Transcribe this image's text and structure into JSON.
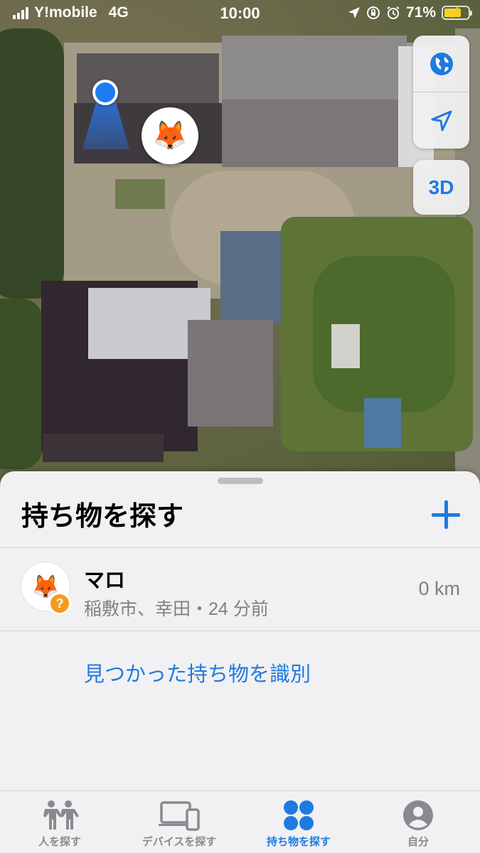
{
  "status_bar": {
    "carrier": "Y!mobile",
    "network": "4G",
    "time": "10:00",
    "battery_percent": "71%",
    "battery_level": 0.71
  },
  "map": {
    "controls": {
      "globe_icon": "globe-icon",
      "location_icon": "location-arrow-icon",
      "threed_label": "3D"
    },
    "pin_icon": "fox-emoji"
  },
  "sheet": {
    "title": "持ち物を探す",
    "add_icon": "plus-icon",
    "items": [
      {
        "name": "マロ",
        "subtitle": "稲敷市、幸田・24 分前",
        "distance": "0 km",
        "icon": "fox-emoji",
        "badge": "?"
      }
    ],
    "identify_link": "見つかった持ち物を識別"
  },
  "tabbar": {
    "tabs": [
      {
        "label": "人を探す",
        "icon": "people-icon",
        "active": false
      },
      {
        "label": "デバイスを探す",
        "icon": "devices-icon",
        "active": false
      },
      {
        "label": "持ち物を探す",
        "icon": "items-icon",
        "active": true
      },
      {
        "label": "自分",
        "icon": "me-icon",
        "active": false
      }
    ]
  },
  "colors": {
    "accent": "#1f7ae0",
    "badge": "#f49b1c",
    "battery": "#f5d320"
  }
}
